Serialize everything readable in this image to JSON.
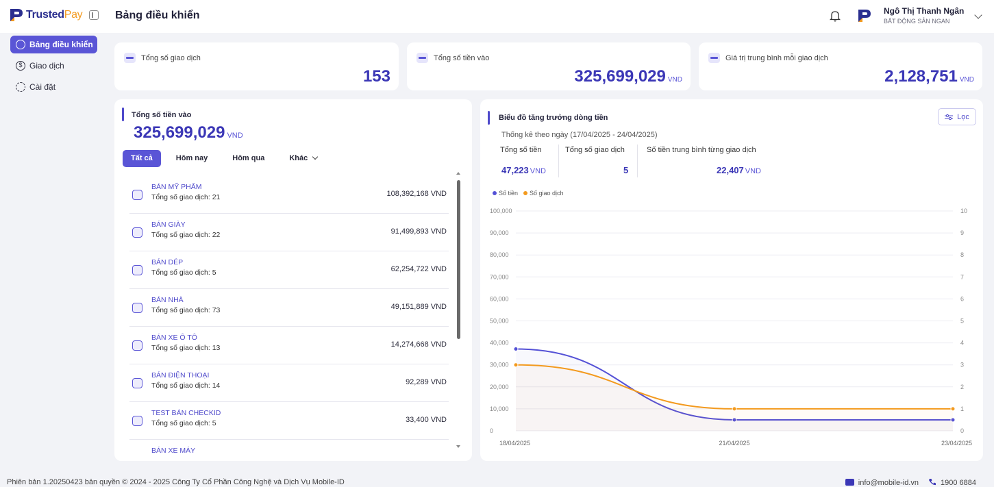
{
  "app": {
    "logo_part1": "Trusted",
    "logo_part2": "Pay",
    "page_title": "Bảng điều khiển"
  },
  "user": {
    "name": "Ngô Thị Thanh Ngân",
    "org": "BẤT ĐỘNG SẢN NGAN"
  },
  "sidebar": {
    "items": [
      {
        "label": "Bảng điều khiển",
        "icon": "home-icon",
        "active": true
      },
      {
        "label": "Giao dịch",
        "icon": "transaction-icon",
        "active": false
      },
      {
        "label": "Cài đặt",
        "icon": "gear-icon",
        "active": false
      }
    ]
  },
  "stats": [
    {
      "label": "Tổng số giao dịch",
      "value": "153",
      "unit": ""
    },
    {
      "label": "Tổng số tiền vào",
      "value": "325,699,029",
      "unit": "VND"
    },
    {
      "label": "Giá trị trung bình mỗi giao dịch",
      "value": "2,128,751",
      "unit": "VND"
    }
  ],
  "income_panel": {
    "title": "Tổng số tiền vào",
    "amount": "325,699,029",
    "unit": "VND",
    "tabs": [
      "Tất cả",
      "Hôm nay",
      "Hôm qua",
      "Khác"
    ],
    "active_tab": "Tất cả",
    "items": [
      {
        "name": "BÁN MỸ PHẨM",
        "count": "Tổng số giao dịch: 21",
        "amount": "108,392,168 VND"
      },
      {
        "name": "BÁN GIÀY",
        "count": "Tổng số giao dịch: 22",
        "amount": "91,499,893 VND"
      },
      {
        "name": "BÁN DÉP",
        "count": "Tổng số giao dịch: 5",
        "amount": "62,254,722 VND"
      },
      {
        "name": "BÁN NHÀ",
        "count": "Tổng số giao dịch: 73",
        "amount": "49,151,889 VND"
      },
      {
        "name": "BÁN XE Ô TÔ",
        "count": "Tổng số giao dịch: 13",
        "amount": "14,274,668 VND"
      },
      {
        "name": "BÁN ĐIỆN THOẠI",
        "count": "Tổng số giao dịch: 14",
        "amount": "92,289 VND"
      },
      {
        "name": "TEST BÁN CHECKID",
        "count": "Tổng số giao dịch: 5",
        "amount": "33,400 VND"
      },
      {
        "name": "BÁN XE MÁY",
        "count": "",
        "amount": ""
      }
    ]
  },
  "growth_panel": {
    "title": "Biểu đồ tăng trưởng dòng tiền",
    "filter_label": "Lọc",
    "caption": "Thống kê theo ngày (17/04/2025 - 24/04/2025)",
    "kpis": [
      {
        "label": "Tổng số tiền",
        "value": "47,223",
        "unit": "VND"
      },
      {
        "label": "Tổng số giao dịch",
        "value": "5",
        "unit": ""
      },
      {
        "label": "Số tiền trung bình từng giao dịch",
        "value": "22,407",
        "unit": "VND"
      }
    ],
    "legend": [
      {
        "name": "Số tiền",
        "color": "#5451d6"
      },
      {
        "name": "Số giao dịch",
        "color": "#f39a1e"
      }
    ]
  },
  "chart_data": {
    "type": "line",
    "x": [
      "18/04/2025",
      "21/04/2025",
      "23/04/2025"
    ],
    "series": [
      {
        "name": "Số tiền",
        "axis": "left",
        "values": [
          37223,
          5000,
          5000
        ],
        "color": "#5451d6"
      },
      {
        "name": "Số giao dịch",
        "axis": "right",
        "values": [
          3,
          1,
          1
        ],
        "color": "#f39a1e"
      }
    ],
    "y_left_ticks": [
      "100,000",
      "90,000",
      "80,000",
      "70,000",
      "60,000",
      "50,000",
      "40,000",
      "30,000",
      "20,000",
      "10,000",
      "0"
    ],
    "y_right_ticks": [
      "10",
      "9",
      "8",
      "7",
      "6",
      "5",
      "4",
      "3",
      "2",
      "1",
      "0"
    ],
    "ylim_left": [
      0,
      100000
    ],
    "ylim_right": [
      0,
      10
    ],
    "grid": true,
    "legend_position": "top-left"
  },
  "footer": {
    "version": "Phiên bản 1.20250423 bản quyền © 2024 - 2025 Công Ty Cổ Phần Công Nghệ và Dịch Vụ Mobile-ID",
    "email": "info@mobile-id.vn",
    "phone": "1900 6884"
  }
}
